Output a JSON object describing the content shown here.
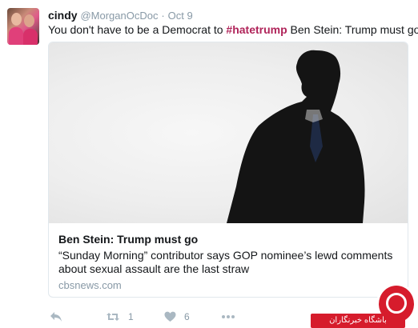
{
  "tweet": {
    "author_name": "cindy",
    "author_handle": "@MorganOcDoc",
    "separator": "·",
    "timestamp": "Oct 9",
    "text_before": "You don't have to be a Democrat to ",
    "hashtag": "#hatetrump",
    "text_after": " Ben Stein: Trump must go"
  },
  "card": {
    "title": "Ben Stein: Trump must go",
    "description": "“Sunday Morning” contributor says GOP nominee’s lewd comments about sexual assault are the last straw",
    "domain": "cbsnews.com"
  },
  "actions": {
    "reply_icon": "reply-icon",
    "retweet_icon": "retweet-icon",
    "retweet_count": "1",
    "like_icon": "heart-icon",
    "like_count": "6",
    "more_icon": "more-icon"
  },
  "watermark": {
    "text": "باشگاه خبرنگاران"
  },
  "colors": {
    "hashtag": "#b0245a",
    "muted": "#8899a6",
    "icon": "#aab8c2",
    "watermark": "#d61c2c"
  }
}
